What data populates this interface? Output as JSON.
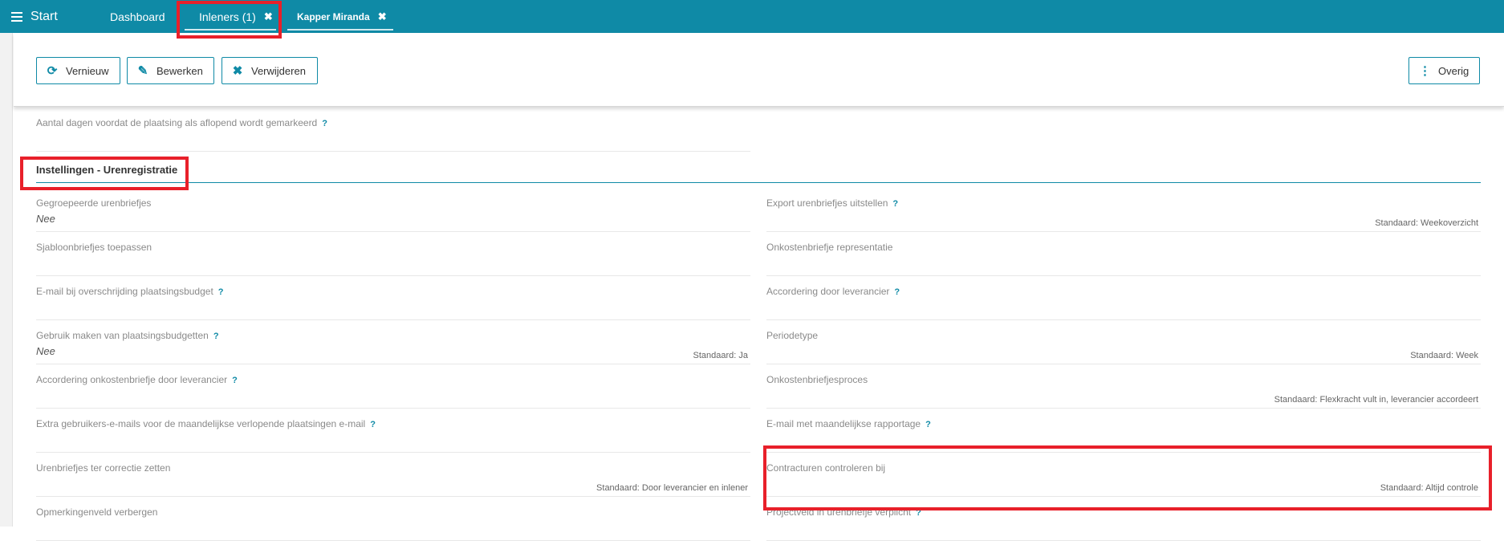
{
  "topbar": {
    "start_label": "Start",
    "tabs": [
      {
        "label": "Dashboard"
      },
      {
        "label": "Inleners (1)",
        "close": "✖"
      },
      {
        "label": "Kapper Miranda",
        "close": "✖"
      }
    ]
  },
  "toolbar": {
    "refresh": {
      "icon": "refresh-icon",
      "glyph": "⟳",
      "label": "Vernieuw"
    },
    "edit": {
      "icon": "pencil-icon",
      "glyph": "✎",
      "label": "Bewerken"
    },
    "delete": {
      "icon": "close-icon",
      "glyph": "✖",
      "label": "Verwijderen"
    },
    "more": {
      "icon": "kebab-icon",
      "glyph": "⋮",
      "label": "Overig"
    }
  },
  "top_field": {
    "label": "Aantal dagen voordat de plaatsing als aflopend wordt gemarkeerd",
    "help": "?"
  },
  "section": {
    "title": "Instellingen - Urenregistratie"
  },
  "left_fields": [
    {
      "label": "Gegroepeerde urenbriefjes",
      "help": "",
      "value": "Nee",
      "default": ""
    },
    {
      "label": "Sjabloonbriefjes toepassen",
      "help": "",
      "value": "",
      "default": ""
    },
    {
      "label": "E-mail bij overschrijding plaatsingsbudget",
      "help": "?",
      "value": "",
      "default": ""
    },
    {
      "label": "Gebruik maken van plaatsingsbudgetten",
      "help": "?",
      "value": "Nee",
      "default": "Standaard: Ja"
    },
    {
      "label": "Accordering onkostenbriefje door leverancier",
      "help": "?",
      "value": "",
      "default": ""
    },
    {
      "label": "Extra gebruikers-e-mails voor de maandelijkse verlopende plaatsingen e-mail",
      "help": "?",
      "value": "",
      "default": ""
    },
    {
      "label": "Urenbriefjes ter correctie zetten",
      "help": "",
      "value": "",
      "default": "Standaard: Door leverancier en inlener"
    },
    {
      "label": "Opmerkingenveld verbergen",
      "help": "",
      "value": "",
      "default": ""
    }
  ],
  "right_fields": [
    {
      "label": "Export urenbriefjes uitstellen",
      "help": "?",
      "value": "",
      "default": "Standaard: Weekoverzicht"
    },
    {
      "label": "Onkostenbriefje representatie",
      "help": "",
      "value": "",
      "default": ""
    },
    {
      "label": "Accordering door leverancier",
      "help": "?",
      "value": "",
      "default": ""
    },
    {
      "label": "Periodetype",
      "help": "",
      "value": "",
      "default": "Standaard: Week"
    },
    {
      "label": "Onkostenbriefjesproces",
      "help": "",
      "value": "",
      "default": "Standaard: Flexkracht vult in, leverancier accordeert"
    },
    {
      "label": "E-mail met maandelijkse rapportage",
      "help": "?",
      "value": "",
      "default": ""
    },
    {
      "label": "Contracturen controleren bij",
      "help": "",
      "value": "",
      "default": "Standaard: Altijd controle"
    },
    {
      "label": "Projectveld in urenbriefje verplicht",
      "help": "?",
      "value": "",
      "default": ""
    }
  ]
}
